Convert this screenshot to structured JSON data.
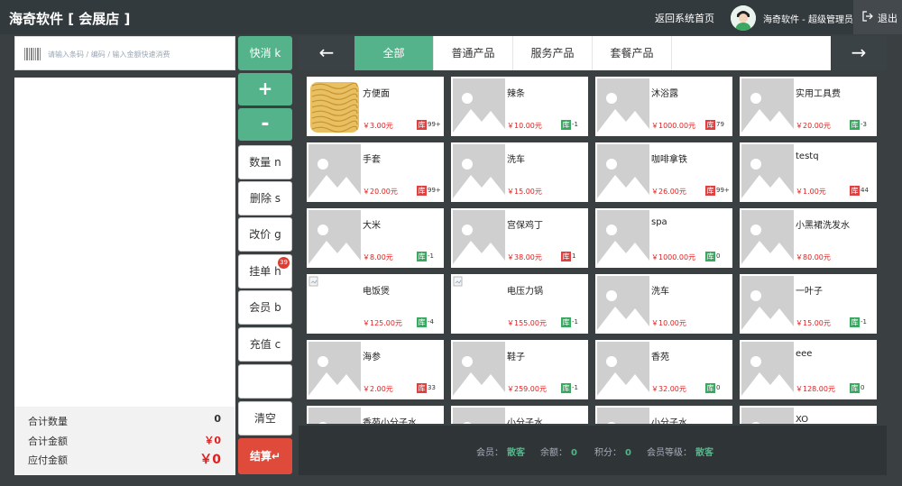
{
  "header": {
    "title": "海奇软件 [ 会展店 ]",
    "home_link": "返回系统首页",
    "user": "海奇软件 - 超级管理员",
    "logout": "退出"
  },
  "scan": {
    "placeholder": "请输入条码 / 编码 / 输入金额快速消费"
  },
  "summary": {
    "qty_label": "合计数量",
    "qty_value": "0",
    "total_label": "合计金额",
    "total_value": "￥0",
    "due_label": "应付金额",
    "due_value": "￥0"
  },
  "actions": {
    "quick": "快消 k",
    "plus": "+",
    "minus": "-",
    "qty": "数量 n",
    "delete": "删除 s",
    "reprice": "改价 g",
    "hold": "挂单 h",
    "hold_badge": "39",
    "member": "会员 b",
    "recharge": "充值 c",
    "blank": "",
    "clear": "清空",
    "checkout": "结算↵"
  },
  "categories": {
    "prev": "←",
    "next": "→",
    "tabs": [
      "全部",
      "普通产品",
      "服务产品",
      "套餐产品"
    ],
    "active": "全部"
  },
  "products": [
    {
      "name": "方便面",
      "price": "￥3.00元",
      "stock_tag": "库",
      "stock_color": "red",
      "stock": "99+",
      "thumb": "noodle"
    },
    {
      "name": "辣条",
      "price": "￥10.00元",
      "stock_tag": "库",
      "stock_color": "green",
      "stock": "-1",
      "thumb": "placeholder"
    },
    {
      "name": "沐浴露",
      "price": "￥1000.00元",
      "stock_tag": "库",
      "stock_color": "red",
      "stock": "79",
      "thumb": "placeholder"
    },
    {
      "name": "实用工具费",
      "price": "￥20.00元",
      "stock_tag": "库",
      "stock_color": "green",
      "stock": "-3",
      "thumb": "placeholder"
    },
    {
      "name": "手套",
      "price": "￥20.00元",
      "stock_tag": "库",
      "stock_color": "red",
      "stock": "99+",
      "thumb": "placeholder"
    },
    {
      "name": "洗车",
      "price": "￥15.00元",
      "stock_tag": "",
      "stock_color": "",
      "stock": "",
      "thumb": "placeholder"
    },
    {
      "name": "咖啡拿铁",
      "price": "￥26.00元",
      "stock_tag": "库",
      "stock_color": "red",
      "stock": "99+",
      "thumb": "placeholder"
    },
    {
      "name": "testq",
      "price": "￥1.00元",
      "stock_tag": "库",
      "stock_color": "red",
      "stock": "44",
      "thumb": "placeholder"
    },
    {
      "name": "大米",
      "price": "￥8.00元",
      "stock_tag": "库",
      "stock_color": "green",
      "stock": "-1",
      "thumb": "placeholder"
    },
    {
      "name": "宫保鸡丁",
      "price": "￥38.00元",
      "stock_tag": "库",
      "stock_color": "red",
      "stock": "1",
      "thumb": "placeholder"
    },
    {
      "name": "spa",
      "price": "￥1000.00元",
      "stock_tag": "库",
      "stock_color": "green",
      "stock": "0",
      "thumb": "placeholder"
    },
    {
      "name": "小黑裙洗发水",
      "price": "￥80.00元",
      "stock_tag": "",
      "stock_color": "",
      "stock": "",
      "thumb": "placeholder"
    },
    {
      "name": "电饭煲",
      "price": "￥125.00元",
      "stock_tag": "库",
      "stock_color": "green",
      "stock": "-4",
      "thumb": "blank"
    },
    {
      "name": "电压力锅",
      "price": "￥155.00元",
      "stock_tag": "库",
      "stock_color": "green",
      "stock": "-1",
      "thumb": "blank"
    },
    {
      "name": "洗车",
      "price": "￥10.00元",
      "stock_tag": "",
      "stock_color": "",
      "stock": "",
      "thumb": "placeholder"
    },
    {
      "name": "一叶子",
      "price": "￥15.00元",
      "stock_tag": "库",
      "stock_color": "green",
      "stock": "-1",
      "thumb": "placeholder"
    },
    {
      "name": "海参",
      "price": "￥2.00元",
      "stock_tag": "库",
      "stock_color": "red",
      "stock": "33",
      "thumb": "placeholder"
    },
    {
      "name": "鞋子",
      "price": "￥259.00元",
      "stock_tag": "库",
      "stock_color": "green",
      "stock": "-1",
      "thumb": "placeholder"
    },
    {
      "name": "香苑",
      "price": "￥32.00元",
      "stock_tag": "库",
      "stock_color": "green",
      "stock": "0",
      "thumb": "placeholder"
    },
    {
      "name": "eee",
      "price": "￥128.00元",
      "stock_tag": "库",
      "stock_color": "green",
      "stock": "0",
      "thumb": "placeholder"
    },
    {
      "name": "香苑小分子水",
      "price": "",
      "stock_tag": "",
      "stock_color": "",
      "stock": "",
      "thumb": "placeholder"
    },
    {
      "name": "小分子水",
      "price": "",
      "stock_tag": "",
      "stock_color": "",
      "stock": "",
      "thumb": "placeholder"
    },
    {
      "name": "小分子水",
      "price": "",
      "stock_tag": "",
      "stock_color": "",
      "stock": "",
      "thumb": "placeholder"
    },
    {
      "name": "XO",
      "price": "",
      "stock_tag": "",
      "stock_color": "",
      "stock": "",
      "thumb": "placeholder"
    }
  ],
  "member_bar": {
    "member_label": "会员：",
    "member_value": "散客",
    "balance_label": "余额：",
    "balance_value": "0",
    "points_label": "积分：",
    "points_value": "0",
    "level_label": "会员等级：",
    "level_value": "散客"
  },
  "colors": {
    "accent": "#54b38a",
    "danger": "#e04a3a",
    "dark": "#3a4042"
  }
}
